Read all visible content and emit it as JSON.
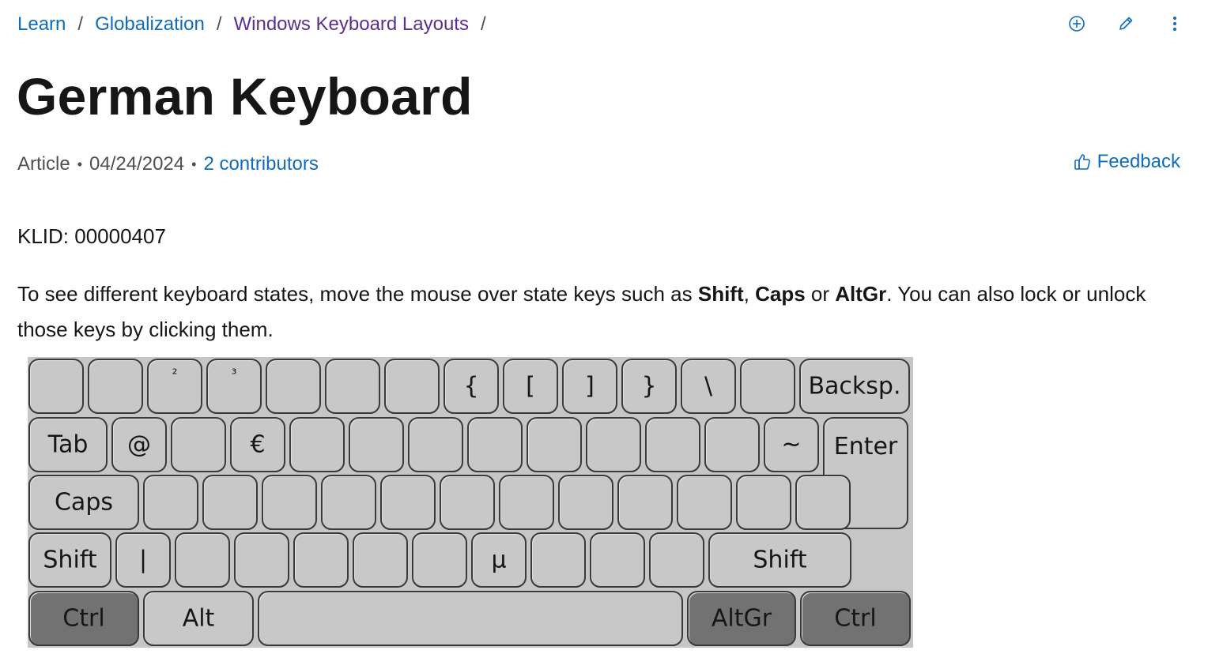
{
  "breadcrumb": {
    "items": [
      "Learn",
      "Globalization",
      "Windows Keyboard Layouts"
    ],
    "separator": "/"
  },
  "actions": {
    "add_icon": "circle-plus-icon",
    "edit_icon": "pencil-icon",
    "more_icon": "more-vertical-icon"
  },
  "title": "German Keyboard",
  "meta": {
    "type": "Article",
    "date": "04/24/2024",
    "contributors": "2 contributors",
    "separator": "•"
  },
  "feedback": {
    "label": "Feedback",
    "icon": "thumbs-up-icon"
  },
  "klid": "KLID: 00000407",
  "intro": {
    "part1": "To see different keyboard states, move the mouse over state keys such as ",
    "shift": "Shift",
    "comma": ", ",
    "caps": "Caps",
    "or": " or ",
    "altgr": "AltGr",
    "part2": ". You can also lock or unlock those keys by clicking them."
  },
  "keyboard": {
    "row1": [
      "",
      "",
      "²",
      "³",
      "",
      "",
      "",
      "{",
      "[",
      "]",
      "}",
      "\\",
      "",
      "Backsp."
    ],
    "row2": [
      "Tab",
      "@",
      "",
      "€",
      "",
      "",
      "",
      "",
      "",
      "",
      "",
      "",
      "~",
      "Enter"
    ],
    "row3": [
      "Caps",
      "",
      "",
      "",
      "",
      "",
      "",
      "",
      "",
      "",
      "",
      "",
      ""
    ],
    "row4": [
      "Shift",
      "|",
      "",
      "",
      "",
      "",
      "",
      "µ",
      "",
      "",
      "",
      "Shift"
    ],
    "row5": [
      "Ctrl",
      "Alt",
      "",
      "AltGr",
      "Ctrl"
    ],
    "pressed_keys": [
      "Ctrl",
      "AltGr"
    ],
    "colors": {
      "key": "#c8c8c8",
      "pressed": "#727272",
      "border": "#3a3a3a",
      "background": "#c6c6c6"
    }
  },
  "colors": {
    "link": "#0f6cbd",
    "visited": "#5c2e91",
    "text": "#161616",
    "muted": "#505050"
  }
}
